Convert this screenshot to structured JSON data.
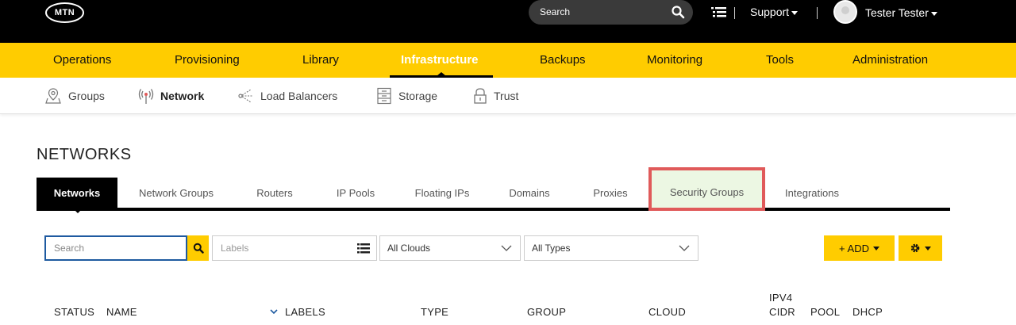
{
  "header": {
    "logo_text": "MTN",
    "search_placeholder": "Search",
    "support_label": "Support",
    "user_name": "Tester Tester"
  },
  "main_nav": {
    "items": [
      "Operations",
      "Provisioning",
      "Library",
      "Infrastructure",
      "Backups",
      "Monitoring",
      "Tools",
      "Administration"
    ],
    "active": "Infrastructure"
  },
  "sub_nav": {
    "items": [
      "Groups",
      "Network",
      "Load Balancers",
      "Storage",
      "Trust"
    ],
    "active": "Network"
  },
  "page": {
    "title": "NETWORKS",
    "tabs": [
      "Networks",
      "Network Groups",
      "Routers",
      "IP Pools",
      "Floating IPs",
      "Domains",
      "Proxies",
      "Security Groups",
      "Integrations"
    ],
    "active_tab": "Networks",
    "highlighted_tab": "Security Groups"
  },
  "filters": {
    "search_placeholder": "Search",
    "labels_placeholder": "Labels",
    "clouds_value": "All Clouds",
    "types_value": "All Types",
    "add_label": "+ ADD"
  },
  "table": {
    "columns": [
      "STATUS",
      "NAME",
      "LABELS",
      "TYPE",
      "GROUP",
      "CLOUD",
      "IPV4",
      "CIDR",
      "POOL",
      "DHCP"
    ]
  },
  "colors": {
    "brand_yellow": "#ffcc00",
    "top_bar": "#000000",
    "highlight_border": "#e05a5a",
    "highlight_fill": "#ecf7e3"
  }
}
